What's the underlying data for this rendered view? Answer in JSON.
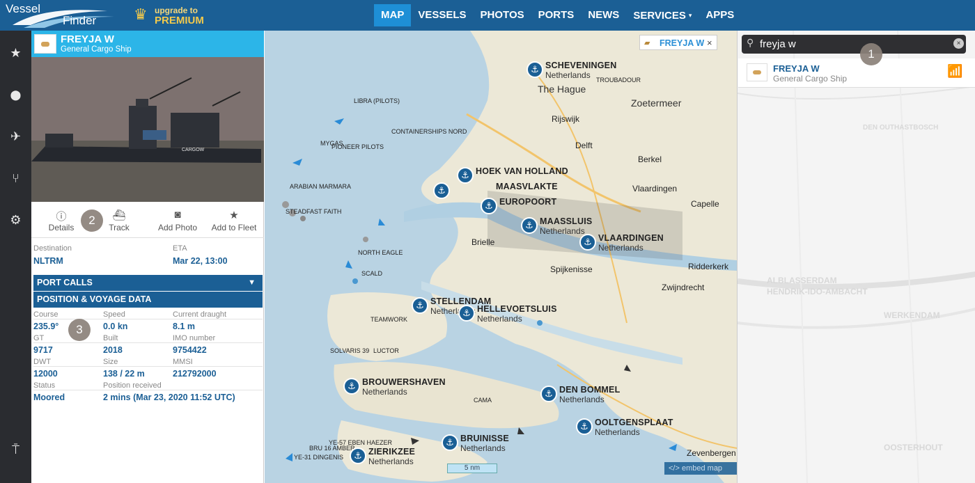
{
  "header": {
    "logo_line1": "Vessel",
    "logo_line2": "Finder",
    "premium_line1": "upgrade to",
    "premium_line2": "PREMIUM",
    "nav": [
      "MAP",
      "VESSELS",
      "PHOTOS",
      "PORTS",
      "NEWS",
      "SERVICES",
      "APPS"
    ],
    "active_nav": "MAP",
    "caret": "▾"
  },
  "rail": {
    "icons": [
      "star-icon",
      "location-pin-icon",
      "satellite-icon",
      "route-icon",
      "gear-icon",
      "antenna-icon"
    ],
    "glyphs": [
      "★",
      "⬤",
      "✈",
      "⑂",
      "⚙",
      "⍑"
    ]
  },
  "vessel": {
    "name": "FREYJA W",
    "type": "General Cargo Ship",
    "photo_text": "CARGOW",
    "actions": [
      {
        "label": "Details",
        "icon": "info-icon",
        "glyph": "ⓘ"
      },
      {
        "label": "Track",
        "icon": "ship-icon",
        "glyph": "⛴"
      },
      {
        "label": "Add Photo",
        "icon": "camera-icon",
        "glyph": "◙"
      },
      {
        "label": "Add to Fleet",
        "icon": "star-icon",
        "glyph": "★"
      }
    ],
    "destination_label": "Destination",
    "destination": "NLTRM",
    "eta_label": "ETA",
    "eta": "Mar 22, 13:00",
    "port_calls_label": "PORT CALLS",
    "position_label": "POSITION & VOYAGE DATA",
    "fields": {
      "course_label": "Course",
      "course": "235.9°",
      "speed_label": "Speed",
      "speed": "0.0 kn",
      "draught_label": "Current draught",
      "draught": "8.1 m",
      "gt_label": "GT",
      "gt": "9717",
      "built_label": "Built",
      "built": "2018",
      "imo_label": "IMO number",
      "imo": "9754422",
      "dwt_label": "DWT",
      "dwt": "12000",
      "size_label": "Size",
      "size": "138 / 22 m",
      "mmsi_label": "MMSI",
      "mmsi": "212792000",
      "status_label": "Status",
      "status": "Moored",
      "position_label": "Position received",
      "position_received": "2 mins (Mar 23, 2020 11:52 UTC)"
    }
  },
  "annotations": [
    "1",
    "2",
    "3"
  ],
  "map": {
    "chip_title": "FREYJA W",
    "chip_close": "×",
    "scale": "5 nm",
    "embed": "</> embed map",
    "ports": [
      {
        "name": "SCHEVENINGEN",
        "country": "Netherlands"
      },
      {
        "name": "HOEK VAN HOLLAND",
        "country": ""
      },
      {
        "name": "MAASVLAKTE",
        "country": ""
      },
      {
        "name": "EUROPOORT",
        "country": ""
      },
      {
        "name": "MAASSLUIS",
        "country": "Netherlands"
      },
      {
        "name": "VLAARDINGEN",
        "country": "Netherlands"
      },
      {
        "name": "STELLENDAM",
        "country": "Netherlands"
      },
      {
        "name": "HELLEVOETSLUIS",
        "country": "Netherlands"
      },
      {
        "name": "BROUWERSHAVEN",
        "country": "Netherlands"
      },
      {
        "name": "DEN BOMMEL",
        "country": "Netherlands"
      },
      {
        "name": "OOLTGENSPLAAT",
        "country": "Netherlands"
      },
      {
        "name": "BRUINISSE",
        "country": "Netherlands"
      },
      {
        "name": "ZIERIKZEE",
        "country": "Netherlands"
      }
    ],
    "places": [
      "The Hague",
      "Zoetermeer",
      "Rijswijk",
      "Delft",
      "Berkel",
      "Capelle",
      "Ridderkerk",
      "Brielle",
      "Spijkenisse",
      "Zwijndrecht",
      "Zevenbergen",
      "Vlaardingen"
    ],
    "vessel_labels": [
      "LIBRA (PILOTS)",
      "CONTAINERSHIPS NORD",
      "MYGAS",
      "PIONEER PILOTS",
      "ARABIAN MARMARA",
      "SCALD",
      "NORTH EAGLE",
      "TEAMWORK",
      "SOLVARIS 39",
      "LUCTOR",
      "YE-57 EBEN HAEZER",
      "BRU 16 AMBER",
      "YE-31 DINGENIS",
      "TROUBADOUR",
      "STEADFAST FAITH",
      "CAMA"
    ]
  },
  "search": {
    "query": "freyja w",
    "clear": "×",
    "result_name": "FREYJA W",
    "result_type": "General Cargo Ship",
    "ghost_places": [
      "ALBLASSERDAM",
      "HENDRIK-IDO-AMBACHT",
      "WERKENDAM",
      "OOSTERHOUT",
      "DEN OUTHASTBOSCH"
    ]
  }
}
